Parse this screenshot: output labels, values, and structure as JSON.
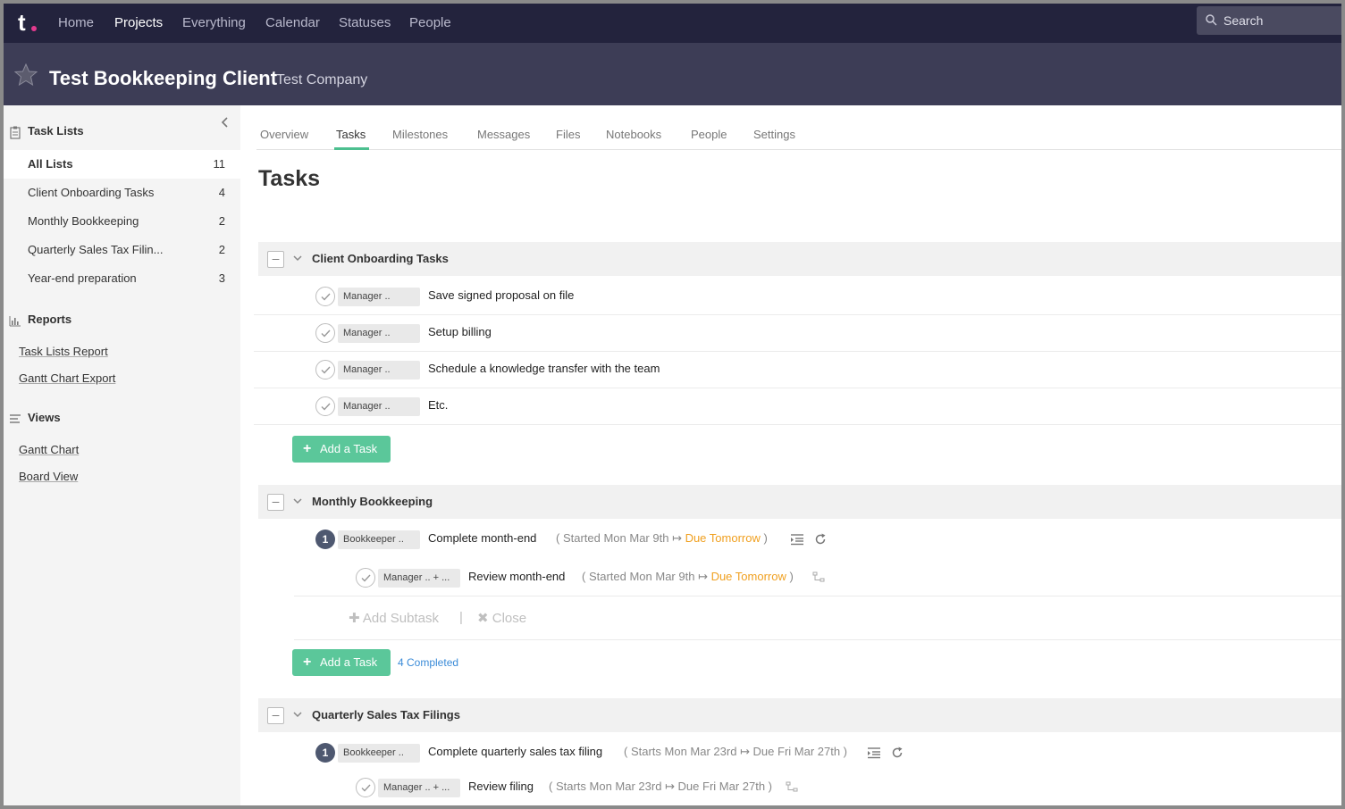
{
  "nav": {
    "logo": "t",
    "items": [
      "Home",
      "Projects",
      "Everything",
      "Calendar",
      "Statuses",
      "People"
    ],
    "active": "Projects",
    "search_placeholder": "Search"
  },
  "project": {
    "title": "Test Bookkeeping Client",
    "company": "Test Company"
  },
  "sidebar": {
    "task_lists_heading": "Task Lists",
    "lists": [
      {
        "label": "All Lists",
        "count": "11"
      },
      {
        "label": "Client Onboarding Tasks",
        "count": "4"
      },
      {
        "label": "Monthly Bookkeeping",
        "count": "2"
      },
      {
        "label": "Quarterly Sales Tax Filin...",
        "count": "2"
      },
      {
        "label": "Year-end preparation",
        "count": "3"
      }
    ],
    "reports_heading": "Reports",
    "reports": [
      "Task Lists Report",
      "Gantt Chart Export"
    ],
    "views_heading": "Views",
    "views": [
      "Gantt Chart",
      "Board View"
    ]
  },
  "tabs": [
    "Overview",
    "Tasks",
    "Milestones",
    "Messages",
    "Files",
    "Notebooks",
    "People",
    "Settings"
  ],
  "active_tab": "Tasks",
  "page_title": "Tasks",
  "task_lists": [
    {
      "title": "Client Onboarding Tasks",
      "tasks": [
        {
          "assignee": "Manager ..",
          "name": "Save signed proposal on file"
        },
        {
          "assignee": "Manager ..",
          "name": "Setup billing"
        },
        {
          "assignee": "Manager ..",
          "name": "Schedule a knowledge transfer with the team"
        },
        {
          "assignee": "Manager ..",
          "name": "Etc."
        }
      ],
      "add_label": "Add a Task"
    },
    {
      "title": "Monthly Bookkeeping",
      "parent": {
        "number": "1",
        "assignee": "Bookkeeper ..",
        "name": "Complete month-end",
        "meta_open": "( Started Mon Mar 9th ↦ ",
        "due": "Due Tomorrow",
        "meta_close": " )"
      },
      "subtask": {
        "assignee": "Manager .. + ...",
        "name": "Review month-end",
        "meta_open": "( Started Mon Mar 9th ↦ ",
        "due": "Due Tomorrow",
        "meta_close": " )"
      },
      "add_subtask": "Add Subtask",
      "separator": "|",
      "close": "Close",
      "add_label": "Add a Task",
      "completed": "4 Completed"
    },
    {
      "title": "Quarterly Sales Tax Filings",
      "parent": {
        "number": "1",
        "assignee": "Bookkeeper ..",
        "name": "Complete quarterly sales tax filing",
        "meta": "( Starts Mon Mar 23rd ↦ Due Fri Mar 27th )"
      },
      "subtask": {
        "assignee": "Manager .. + ...",
        "name": "Review filing",
        "meta": "( Starts Mon Mar 23rd ↦ Due Fri Mar 27th )"
      }
    }
  ]
}
